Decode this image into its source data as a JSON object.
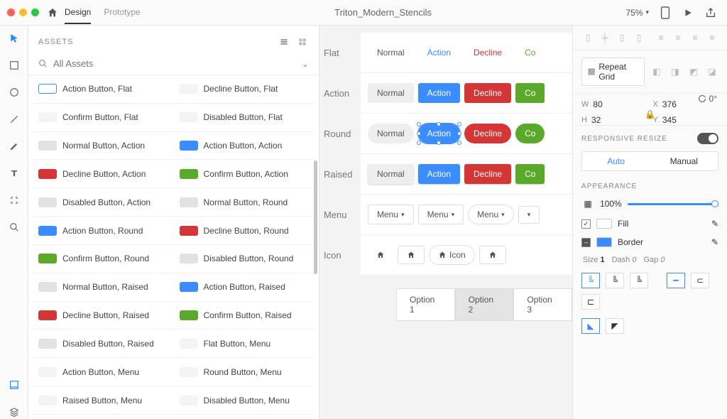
{
  "topbar": {
    "tabs": {
      "design": "Design",
      "prototype": "Prototype"
    },
    "title": "Triton_Modern_Stencils",
    "zoom": "75%"
  },
  "assets": {
    "title": "ASSETS",
    "search_placeholder": "All Assets",
    "items": [
      {
        "swatch": "sw-outline",
        "label": "Action Button, Flat"
      },
      {
        "swatch": "sw-light",
        "label": "Decline Button, Flat"
      },
      {
        "swatch": "sw-light",
        "label": "Confirm Button, Flat"
      },
      {
        "swatch": "sw-light",
        "label": "Disabled Button, Flat"
      },
      {
        "swatch": "sw-grey",
        "label": "Normal Button, Action"
      },
      {
        "swatch": "sw-blue",
        "label": "Action Button, Action"
      },
      {
        "swatch": "sw-red",
        "label": "Decline Button, Action"
      },
      {
        "swatch": "sw-green",
        "label": "Confirm Button, Action"
      },
      {
        "swatch": "sw-grey",
        "label": "Disabled Button, Action"
      },
      {
        "swatch": "sw-grey",
        "label": "Normal Button, Round"
      },
      {
        "swatch": "sw-blue",
        "label": "Action Button, Round"
      },
      {
        "swatch": "sw-red",
        "label": "Decline Button, Round"
      },
      {
        "swatch": "sw-green",
        "label": "Confirm Button, Round"
      },
      {
        "swatch": "sw-grey",
        "label": "Disabled Button, Round"
      },
      {
        "swatch": "sw-grey",
        "label": "Normal Button, Raised"
      },
      {
        "swatch": "sw-blue",
        "label": "Action Button, Raised"
      },
      {
        "swatch": "sw-red",
        "label": "Decline Button, Raised"
      },
      {
        "swatch": "sw-green",
        "label": "Confirm Button, Raised"
      },
      {
        "swatch": "sw-grey",
        "label": "Disabled Button, Raised"
      },
      {
        "swatch": "sw-light",
        "label": "Flat Button, Menu"
      },
      {
        "swatch": "sw-light",
        "label": "Action Button, Menu"
      },
      {
        "swatch": "sw-light",
        "label": "Round Button, Menu"
      },
      {
        "swatch": "sw-light",
        "label": "Raised Button, Menu"
      },
      {
        "swatch": "sw-light",
        "label": "Disabled Button, Menu"
      }
    ]
  },
  "canvas": {
    "rows": {
      "flat": "Flat",
      "action": "Action",
      "round": "Round",
      "raised": "Raised",
      "menu": "Menu",
      "icon": "Icon"
    },
    "labels": {
      "normal": "Normal",
      "action": "Action",
      "decline": "Decline",
      "confirm": "Co",
      "menu": "Menu",
      "icon": "Icon"
    },
    "artboard_tabs": [
      "Option 1",
      "Option 2",
      "Option 3"
    ]
  },
  "inspector": {
    "repeat_grid": "Repeat Grid",
    "w_label": "W",
    "w": "80",
    "h_label": "H",
    "h": "32",
    "x_label": "X",
    "x": "376",
    "y_label": "Y",
    "y": "345",
    "rotate": "0°",
    "responsive": "RESPONSIVE RESIZE",
    "auto": "Auto",
    "manual": "Manual",
    "appearance": "APPEARANCE",
    "opacity": "100%",
    "fill": "Fill",
    "border": "Border",
    "size_label": "Size",
    "size": "1",
    "dash_label": "Dash",
    "dash": "0",
    "gap_label": "Gap",
    "gap": "0"
  }
}
